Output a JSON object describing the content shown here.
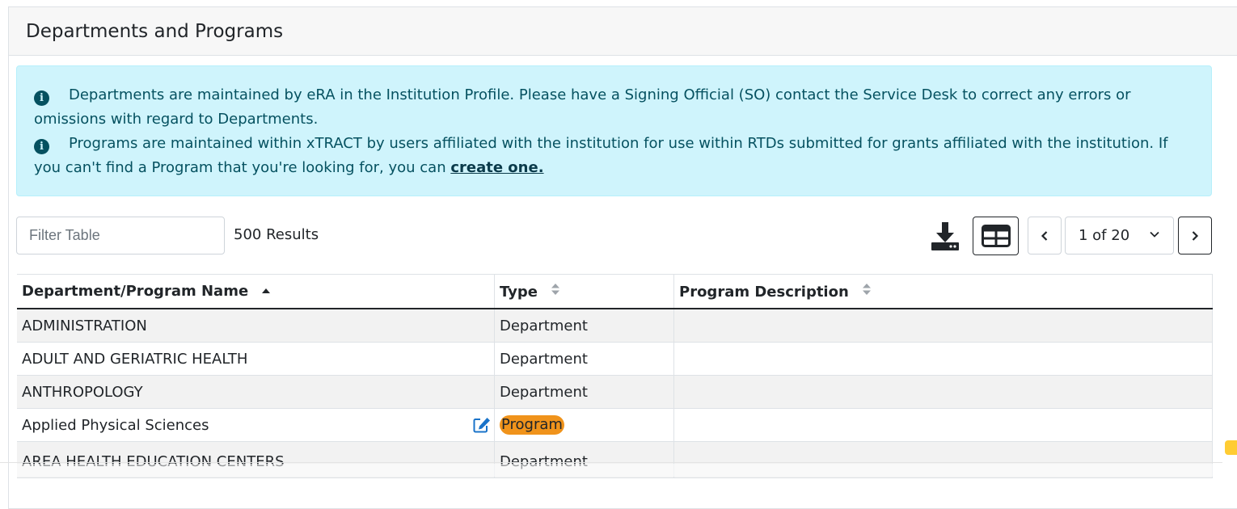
{
  "card": {
    "title": "Departments and Programs"
  },
  "alert": {
    "line1": "Departments are maintained by eRA in the Institution Profile. Please have a Signing Official (SO) contact the Service Desk to correct any errors or omissions with regard to Departments.",
    "line2_text": "Programs are maintained within xTRACT by users affiliated with the institution for use within RTDs submitted for grants affiliated with the institution. If you can't find a Program that you're looking for, you can ",
    "line2_link": "create one."
  },
  "toolbar": {
    "filter_placeholder": "Filter Table",
    "results": "500 Results",
    "page_value": "1 of 20"
  },
  "table": {
    "headers": [
      "Department/Program Name",
      "Type",
      "Program Description"
    ],
    "rows": [
      {
        "name": "ADMINISTRATION",
        "type": "Department",
        "description": ""
      },
      {
        "name": "ADULT AND GERIATRIC HEALTH",
        "type": "Department",
        "description": ""
      },
      {
        "name": "ANTHROPOLOGY",
        "type": "Department",
        "description": ""
      },
      {
        "name": "Applied Physical Sciences",
        "type": "Program",
        "description": ""
      },
      {
        "name": "AREA HEALTH EDUCATION CENTERS",
        "type": "Department",
        "description": ""
      }
    ]
  },
  "colors": {
    "alert_bg": "#cff4fc",
    "alert_text": "#055160",
    "program_badge": "#f0931b",
    "edit_icon": "#1a73c9"
  },
  "icons": [
    "info-icon",
    "download-icon",
    "table-view-icon",
    "chevron-left-icon",
    "chevron-down-icon",
    "chevron-right-icon",
    "sort-asc-icon",
    "sort-icon",
    "edit-icon"
  ]
}
